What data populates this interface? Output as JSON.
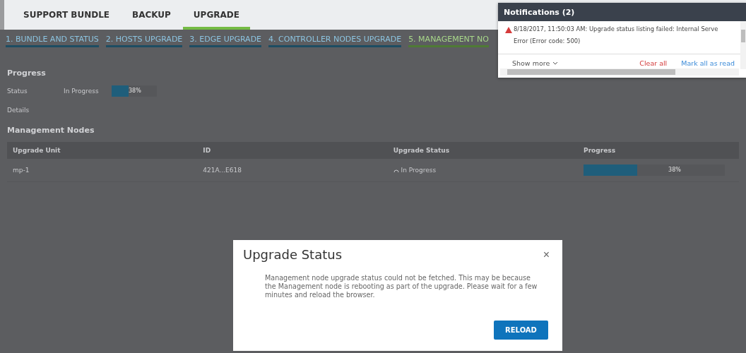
{
  "tabs": [
    {
      "label": "SUPPORT BUNDLE",
      "selected": false
    },
    {
      "label": "BACKUP",
      "selected": false
    },
    {
      "label": "UPGRADE",
      "selected": true
    }
  ],
  "steps": [
    {
      "label": "1. BUNDLE AND STATUS",
      "selected": false
    },
    {
      "label": "2. HOSTS UPGRADE",
      "selected": false
    },
    {
      "label": "3. EDGE UPGRADE",
      "selected": false
    },
    {
      "label": "4. CONTROLLER NODES UPGRADE",
      "selected": false
    },
    {
      "label": "5. MANAGEMENT NO",
      "selected": true
    }
  ],
  "progress": {
    "title": "Progress",
    "status_label": "Status",
    "status": "In Progress",
    "level": 0.38,
    "reading": "38%",
    "details_label": "Details"
  },
  "management_nodes": {
    "title": "Management Nodes",
    "columns": [
      "Upgrade Unit",
      "ID",
      "Upgrade Status",
      "Progress"
    ],
    "rows": [
      {
        "unit": "mp-1",
        "id": "421A...E618",
        "status": "In Progress",
        "level": 0.38,
        "reading": "38%"
      }
    ]
  },
  "notifications": {
    "title": "Notifications (2)",
    "items": [
      {
        "text": "8/18/2017, 11:50:03 AM: Upgrade status listing failed: Internal Serve\nError (Error code: 500)"
      }
    ],
    "show_more": "Show more",
    "clear_all": "Clear all",
    "mark_all_read": "Mark all as read"
  },
  "dialog": {
    "title": "Upgrade Status",
    "close": "×",
    "message": "Management node upgrade status could not be fetched. This may be because the Management node is rebooting as part of the upgrade. Please wait for a few minutes and reload the browser.",
    "button": "RELOAD"
  }
}
